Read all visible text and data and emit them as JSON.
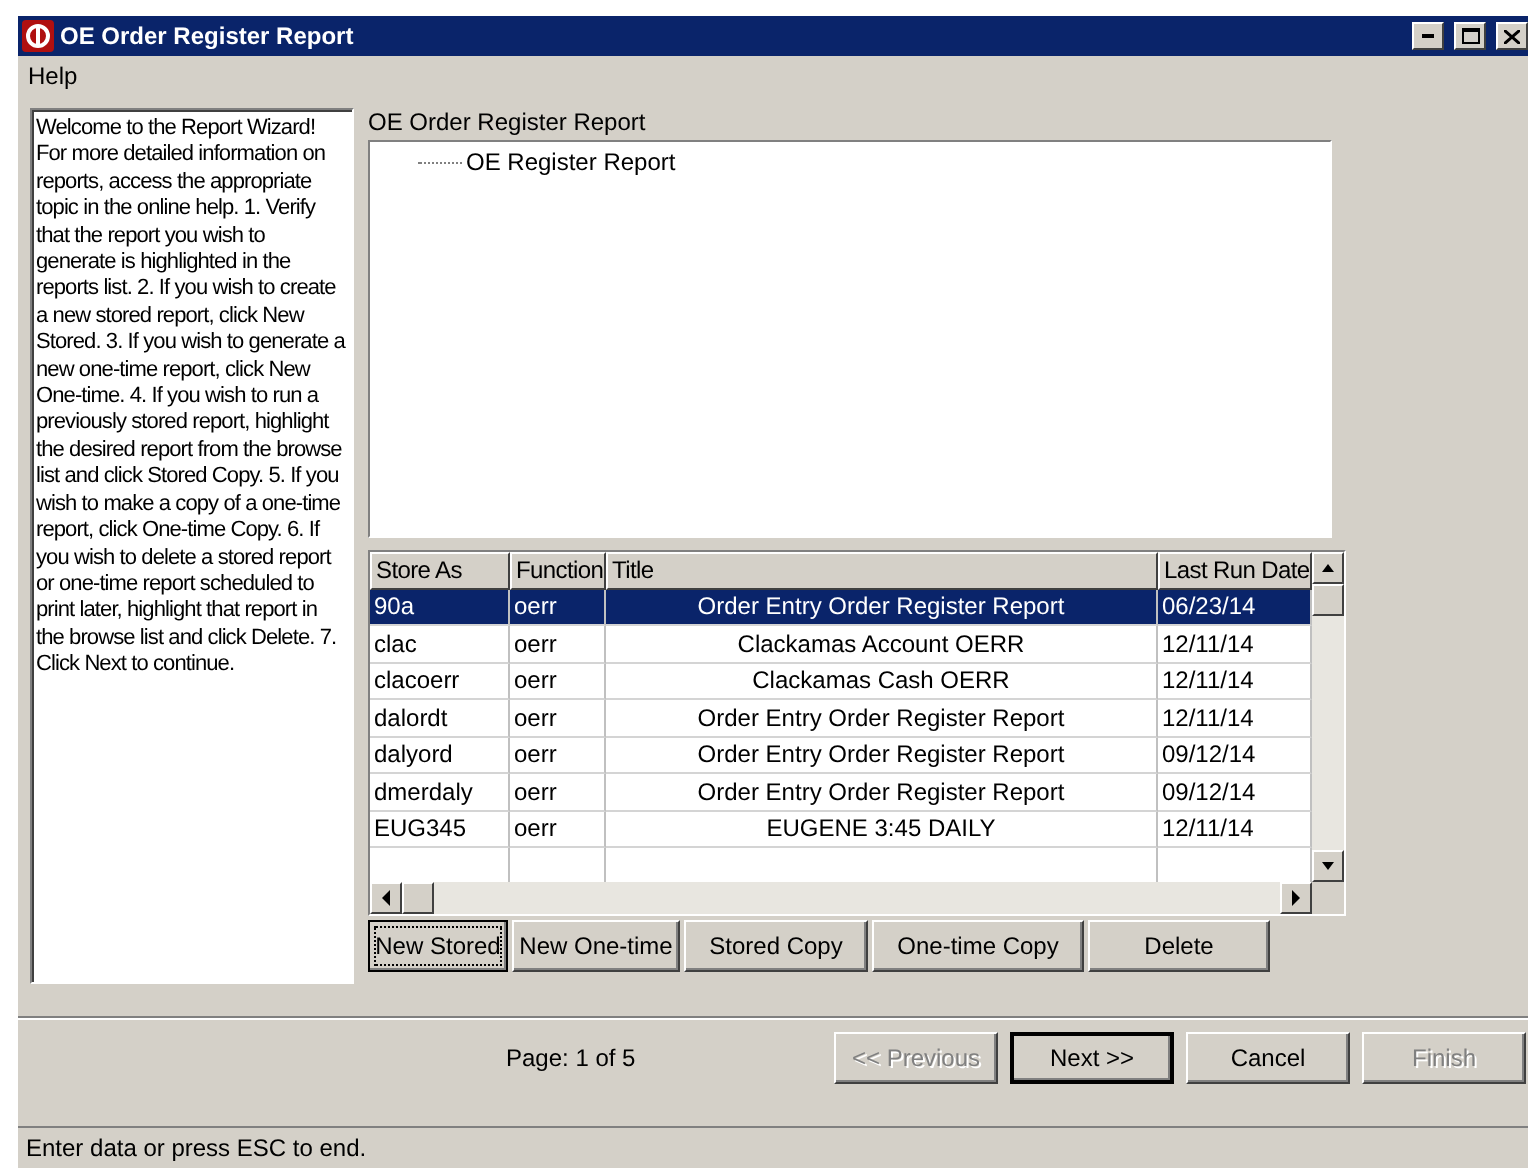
{
  "window": {
    "title": "OE Order Register Report"
  },
  "menu": [
    "Help"
  ],
  "help_text": "Welcome to the Report Wizard!  For more detailed information on reports, access the appropriate topic in the online help.  1. Verify that the report you wish to generate is highlighted in the reports list. 2. If you wish to create a new stored report, click New Stored. 3. If you wish to generate a new one-time report, click New One-time. 4. If you wish to run a previously stored report, highlight the desired report from the browse list and click Stored Copy. 5. If you wish to make a copy of a one-time report, click One-time Copy. 6. If you wish to delete a stored report or one-time report scheduled to print later, highlight that report in the browse list and click Delete. 7. Click Next to continue.",
  "tree": {
    "label": "OE Order Register Report",
    "items": [
      {
        "label": "OE Register Report"
      }
    ]
  },
  "table": {
    "columns": [
      "Store As",
      "Function",
      "Title",
      "Last Run Date"
    ],
    "rows": [
      {
        "store_as": "90a",
        "function": "oerr",
        "title": "Order Entry Order Register Report",
        "last_run_date": "06/23/14",
        "selected": true
      },
      {
        "store_as": "clac",
        "function": "oerr",
        "title": "Clackamas Account OERR",
        "last_run_date": "12/11/14",
        "selected": false
      },
      {
        "store_as": "clacoerr",
        "function": "oerr",
        "title": "Clackamas Cash OERR",
        "last_run_date": "12/11/14",
        "selected": false
      },
      {
        "store_as": "dalordt",
        "function": "oerr",
        "title": "Order Entry Order Register Report",
        "last_run_date": "12/11/14",
        "selected": false
      },
      {
        "store_as": "dalyord",
        "function": "oerr",
        "title": "Order Entry Order Register Report",
        "last_run_date": "09/12/14",
        "selected": false
      },
      {
        "store_as": "dmerdaly",
        "function": "oerr",
        "title": "Order Entry Order Register Report",
        "last_run_date": "09/12/14",
        "selected": false
      },
      {
        "store_as": "EUG345",
        "function": "oerr",
        "title": "EUGENE 3:45 DAILY",
        "last_run_date": "12/11/14",
        "selected": false
      }
    ]
  },
  "report_buttons": [
    {
      "label": "New Stored",
      "focused": true
    },
    {
      "label": "New One-time",
      "focused": false
    },
    {
      "label": "Stored Copy",
      "focused": false
    },
    {
      "label": "One-time Copy",
      "focused": false
    },
    {
      "label": "Delete",
      "focused": false
    }
  ],
  "page": "Page:  1 of 5",
  "nav_buttons": [
    {
      "label": "<< Previous",
      "disabled": true,
      "default": false
    },
    {
      "label": "Next >>",
      "disabled": false,
      "default": true
    },
    {
      "label": "Cancel",
      "disabled": false,
      "default": false
    },
    {
      "label": "Finish",
      "disabled": true,
      "default": false
    }
  ],
  "status_bar": "Enter data or press ESC to end."
}
